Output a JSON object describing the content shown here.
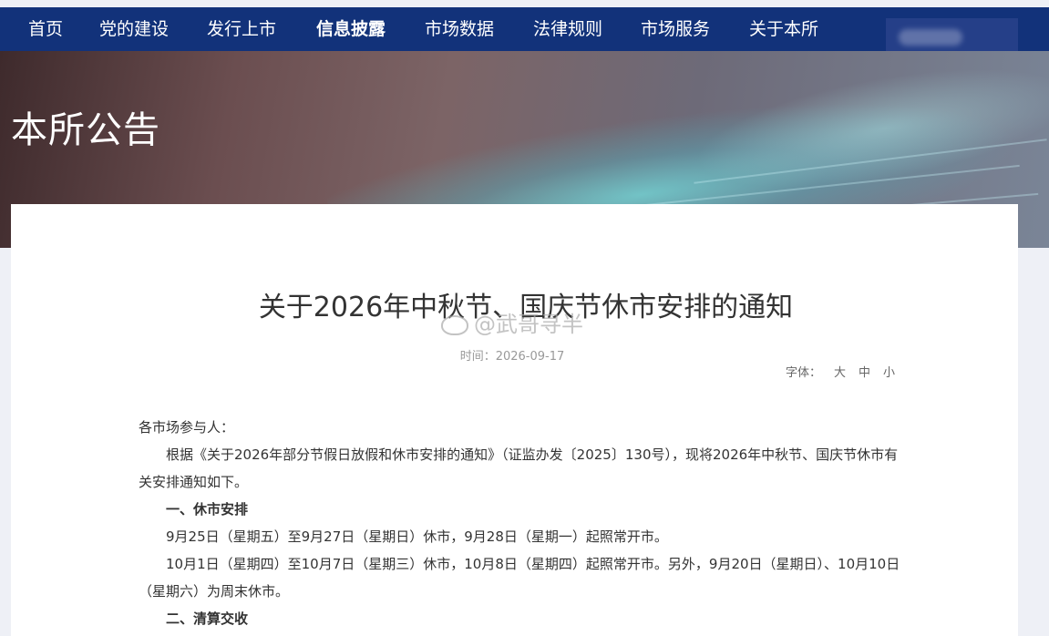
{
  "nav": {
    "items": [
      {
        "label": "首页"
      },
      {
        "label": "党的建设"
      },
      {
        "label": "发行上市"
      },
      {
        "label": "信息披露"
      },
      {
        "label": "市场数据"
      },
      {
        "label": "法律规则"
      },
      {
        "label": "市场服务"
      },
      {
        "label": "关于本所"
      }
    ],
    "active_index": 3
  },
  "banner": {
    "title": "本所公告"
  },
  "article": {
    "title": "关于2026年中秋节、国庆节休市安排的通知",
    "time": "时间：2026-09-17",
    "font_size": {
      "label": "字体：",
      "large": "大",
      "medium": "中",
      "small": "小"
    },
    "watermark": "@武哥寻半",
    "paragraphs": {
      "salutation": "各市场参与人：",
      "intro_1": "根据《关于2026年部分节假日放假和休市安排的通知》（证监办发〔2025〕130号），现将2026年中秋节、国庆节休市有",
      "intro_2": "关安排通知如下。",
      "section_1": "一、休市安排",
      "line_1": "9月25日（星期五）至9月27日（星期日）休市，9月28日（星期一）起照常开市。",
      "line_2a": "10月1日（星期四）至10月7日（星期三）休市，10月8日（星期四）起照常开市。另外，9月20日（星期日）、10月10日",
      "line_2b": "（星期六）为周末休市。",
      "section_2": "二、清算交收"
    }
  },
  "colors": {
    "nav_bg": "#12327a",
    "nav_active_underline": "#d93b3b",
    "page_bg": "#eef0f6"
  }
}
